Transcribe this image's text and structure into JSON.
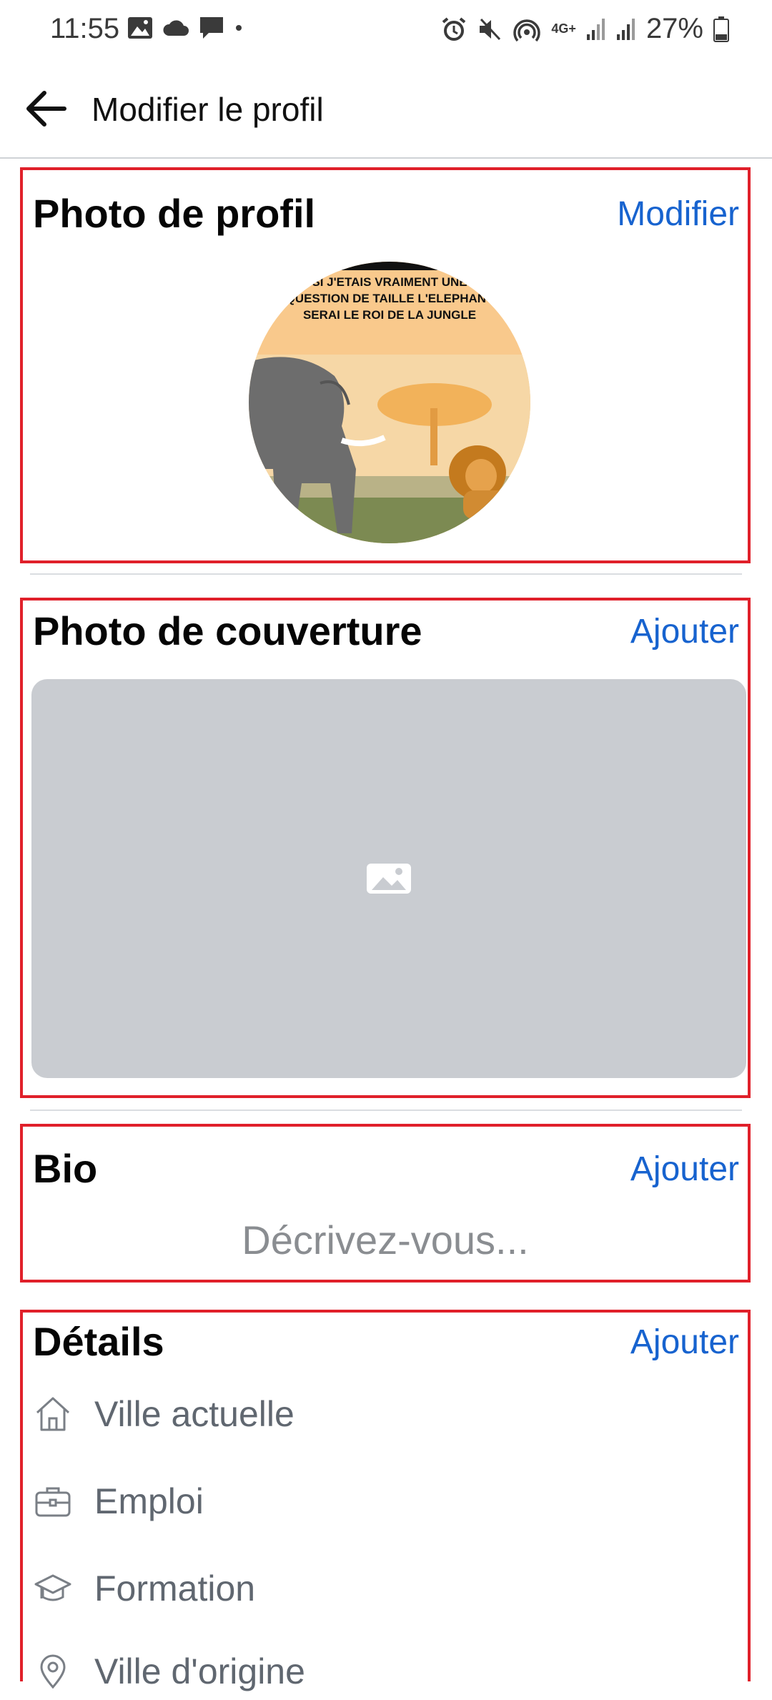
{
  "status_bar": {
    "time": "11:55",
    "network": "4G+",
    "battery": "27%"
  },
  "header": {
    "title": "Modifier le profil",
    "back_icon": "arrow-left-icon"
  },
  "profile_photo": {
    "title": "Photo de profil",
    "action": "Modifier",
    "image_text_lines": [
      "SI J'ETAIS VRAIMENT UNE",
      "QUESTION DE TAILLE L'ELEPHANT",
      "SERAI LE ROI DE LA JUNGLE"
    ]
  },
  "cover_photo": {
    "title": "Photo de couverture",
    "action": "Ajouter",
    "placeholder_icon": "image-icon"
  },
  "bio": {
    "title": "Bio",
    "action": "Ajouter",
    "placeholder": "Décrivez-vous..."
  },
  "details": {
    "title": "Détails",
    "action": "Ajouter",
    "items": [
      {
        "label": "Ville actuelle",
        "icon": "home-icon"
      },
      {
        "label": "Emploi",
        "icon": "briefcase-icon"
      },
      {
        "label": "Formation",
        "icon": "graduation-cap-icon"
      },
      {
        "label": "Ville d'origine",
        "icon": "location-pin-icon"
      }
    ]
  },
  "colors": {
    "accent": "#1763cf",
    "highlight_border": "#e0202a",
    "cover_placeholder": "#c9ccd1"
  }
}
